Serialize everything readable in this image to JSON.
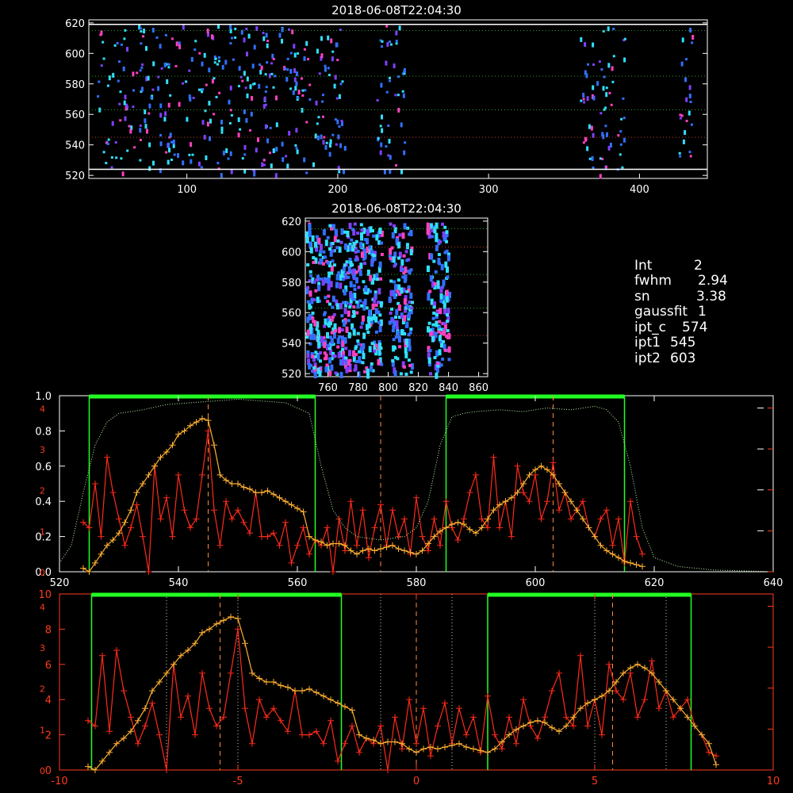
{
  "colors": {
    "axis_white": "#ffffff",
    "axis_red": "#ff3b1f",
    "profile_red": "#ff2a1a",
    "profile_orange": "#ffb030",
    "window_green": "#22ff22",
    "transmission": "#b8f7a8",
    "ref_dashed": "#ff8c3a",
    "grid_dot_green": "#2aa02a",
    "grid_dot_red": "#c04020",
    "pixel_blue": "#3070ff",
    "pixel_cyan": "#30e0ff",
    "pixel_purple": "#8040ff",
    "pixel_magenta": "#ff40c0"
  },
  "panels": {
    "top_title": "2018-06-08T22:04:30",
    "mid_title": "2018-06-08T22:04:30"
  },
  "info": {
    "int_label": "Int",
    "int_value": "2",
    "fwhm_label": "fwhm",
    "fwhm_value": "2.94",
    "sn_label": "sn",
    "sn_value": "3.38",
    "gaussfit_label": "gaussfit",
    "gaussfit_value": "1",
    "ipt_c_label": "ipt_c",
    "ipt_c_value": "574",
    "ipt1_label": "ipt1",
    "ipt1_value": "545",
    "ipt2_label": "ipt2",
    "ipt2_value": "603"
  },
  "chart_data": [
    {
      "type": "heatmap",
      "title": "2018-06-08T22:04:30",
      "xlim": [
        35,
        445
      ],
      "ylim": [
        518,
        622
      ],
      "xticks": [
        "100",
        "200",
        "300",
        "400"
      ],
      "yticks": [
        "520",
        "540",
        "560",
        "580",
        "600",
        "620"
      ],
      "band_columns": [
        [
          40,
          205
        ],
        [
          225,
          245
        ],
        [
          360,
          390
        ],
        [
          425,
          435
        ]
      ],
      "white_lines_y": [
        524,
        619
      ],
      "green_dotted_y": [
        585,
        563,
        615
      ],
      "red_dotted_y": [
        545
      ]
    },
    {
      "type": "heatmap",
      "title": "2018-06-08T22:04:30",
      "xlim": [
        745,
        866
      ],
      "ylim": [
        518,
        622
      ],
      "xticks": [
        "760",
        "780",
        "800",
        "820",
        "840",
        "860"
      ],
      "yticks": [
        "520",
        "540",
        "560",
        "580",
        "600",
        "620"
      ],
      "band_columns": [
        [
          745,
          775
        ],
        [
          775,
          795
        ],
        [
          800,
          815
        ],
        [
          825,
          840
        ]
      ],
      "green_dotted_y": [
        585,
        563,
        615
      ],
      "red_dotted_y": [
        545,
        603
      ]
    },
    {
      "type": "line",
      "xlim": [
        520,
        640
      ],
      "ylim": [
        0,
        1.0
      ],
      "xticks": [
        "520",
        "540",
        "560",
        "580",
        "600",
        "620",
        "640"
      ],
      "yticks": [
        "0.0",
        "0.2",
        "0.4",
        "0.6",
        "0.8",
        "1.0"
      ],
      "right_axis_ticks": [
        "0",
        "1",
        "2",
        "3",
        "4"
      ],
      "left_overlay_ticks": [
        "0",
        "1",
        "2",
        "3",
        "4"
      ],
      "green_windows": [
        [
          525,
          563
        ],
        [
          585,
          615
        ]
      ],
      "dashed_lines_x": [
        545,
        574,
        603
      ],
      "series": [
        {
          "role": "profile_red",
          "x": [
            524,
            525,
            526,
            527,
            528,
            529,
            530,
            531,
            532,
            533,
            534,
            535,
            536,
            537,
            538,
            539,
            540,
            541,
            542,
            543,
            544,
            545,
            546,
            547,
            548,
            549,
            550,
            551,
            552,
            553,
            554,
            555,
            556,
            557,
            558,
            559,
            560,
            561,
            562,
            563,
            564,
            565,
            566,
            567,
            568,
            569,
            570,
            571,
            572,
            573,
            574,
            575,
            576,
            577,
            578,
            579,
            580,
            581,
            582,
            583,
            584,
            585,
            586,
            587,
            588,
            589,
            590,
            591,
            592,
            593,
            594,
            595,
            596,
            597,
            598,
            599,
            600,
            601,
            602,
            603,
            604,
            605,
            606,
            607,
            608,
            609,
            610,
            611,
            612,
            613,
            614,
            615,
            616,
            617,
            618
          ],
          "y": [
            0.28,
            0.25,
            0.5,
            0.2,
            0.65,
            0.45,
            0.3,
            0.15,
            0.25,
            0.38,
            0.2,
            0.0,
            0.6,
            0.3,
            0.42,
            0.2,
            0.55,
            0.35,
            0.25,
            0.3,
            0.55,
            0.8,
            0.35,
            0.15,
            0.4,
            0.3,
            0.35,
            0.28,
            0.22,
            0.45,
            0.2,
            0.2,
            0.22,
            0.15,
            0.28,
            0.05,
            0.15,
            0.25,
            0.1,
            0.18,
            0.15,
            0.25,
            0.0,
            0.3,
            0.12,
            0.4,
            0.15,
            0.35,
            0.08,
            0.25,
            0.38,
            0.15,
            0.35,
            0.2,
            0.3,
            0.1,
            0.42,
            0.2,
            0.12,
            0.3,
            0.15,
            0.4,
            0.25,
            0.18,
            0.3,
            0.45,
            0.55,
            0.3,
            0.25,
            0.65,
            0.25,
            0.4,
            0.2,
            0.6,
            0.45,
            0.4,
            0.55,
            0.3,
            0.4,
            0.62,
            0.35,
            0.45,
            0.3,
            0.35,
            0.4,
            0.25,
            0.2,
            0.3,
            0.35,
            0.15,
            0.3,
            0.05,
            0.4,
            0.2,
            0.1
          ]
        },
        {
          "role": "profile_orange",
          "x": [
            524,
            525,
            526,
            527,
            528,
            529,
            530,
            531,
            532,
            533,
            534,
            535,
            536,
            537,
            538,
            539,
            540,
            541,
            542,
            543,
            544,
            545,
            546,
            547,
            548,
            549,
            550,
            551,
            552,
            553,
            554,
            555,
            556,
            557,
            558,
            559,
            560,
            561,
            562,
            563,
            564,
            565,
            566,
            567,
            568,
            569,
            570,
            571,
            572,
            573,
            574,
            575,
            576,
            577,
            578,
            579,
            580,
            581,
            582,
            583,
            584,
            585,
            586,
            587,
            588,
            589,
            590,
            591,
            592,
            593,
            594,
            595,
            596,
            597,
            598,
            599,
            600,
            601,
            602,
            603,
            604,
            605,
            606,
            607,
            608,
            609,
            610,
            611,
            612,
            613,
            614,
            615,
            616,
            617,
            618
          ],
          "y": [
            0.02,
            0.0,
            0.05,
            0.1,
            0.15,
            0.18,
            0.22,
            0.28,
            0.35,
            0.45,
            0.5,
            0.55,
            0.6,
            0.65,
            0.68,
            0.72,
            0.78,
            0.8,
            0.83,
            0.85,
            0.87,
            0.86,
            0.72,
            0.55,
            0.52,
            0.5,
            0.5,
            0.48,
            0.47,
            0.45,
            0.45,
            0.46,
            0.44,
            0.42,
            0.4,
            0.38,
            0.36,
            0.34,
            0.2,
            0.18,
            0.17,
            0.15,
            0.16,
            0.16,
            0.15,
            0.12,
            0.1,
            0.12,
            0.13,
            0.12,
            0.13,
            0.14,
            0.15,
            0.13,
            0.12,
            0.11,
            0.1,
            0.12,
            0.16,
            0.2,
            0.23,
            0.25,
            0.27,
            0.28,
            0.27,
            0.24,
            0.22,
            0.25,
            0.3,
            0.35,
            0.38,
            0.4,
            0.42,
            0.45,
            0.5,
            0.55,
            0.58,
            0.6,
            0.58,
            0.55,
            0.5,
            0.45,
            0.4,
            0.35,
            0.3,
            0.25,
            0.2,
            0.15,
            0.12,
            0.1,
            0.08,
            0.06,
            0.05,
            0.04,
            0.03
          ]
        },
        {
          "role": "transmission",
          "x": [
            520,
            522,
            524,
            526,
            528,
            530,
            534,
            538,
            542,
            546,
            550,
            554,
            558,
            562,
            564,
            566,
            568,
            570,
            574,
            578,
            580,
            582,
            584,
            586,
            588,
            590,
            594,
            598,
            602,
            606,
            610,
            612,
            614,
            616,
            618,
            620,
            624,
            630,
            640
          ],
          "y": [
            0.05,
            0.15,
            0.45,
            0.72,
            0.85,
            0.9,
            0.92,
            0.95,
            0.96,
            0.97,
            0.98,
            0.97,
            0.96,
            0.9,
            0.6,
            0.35,
            0.25,
            0.2,
            0.18,
            0.2,
            0.25,
            0.4,
            0.72,
            0.88,
            0.9,
            0.91,
            0.92,
            0.91,
            0.93,
            0.92,
            0.94,
            0.92,
            0.85,
            0.6,
            0.25,
            0.08,
            0.03,
            0.01,
            0.0
          ]
        }
      ]
    },
    {
      "type": "line",
      "xlim": [
        -10,
        10
      ],
      "ylim": [
        0,
        10
      ],
      "xticks": [
        "-10",
        "-5",
        "0",
        "5",
        "10"
      ],
      "yticks": [
        "0",
        "2",
        "4",
        "6",
        "8",
        "10"
      ],
      "left_overlay_ticks": [
        "0",
        "1",
        "2",
        "3",
        "4"
      ],
      "green_windows": [
        [
          -9.1,
          -2.1
        ],
        [
          2,
          7.7
        ]
      ],
      "dashed_lines_x": [
        -5.5,
        0,
        5.5
      ],
      "dotted_lines_x": [
        -7,
        -5,
        -1,
        1,
        5,
        7
      ],
      "series": [
        {
          "role": "profile_red",
          "x": [
            -9.2,
            -9.0,
            -8.8,
            -8.6,
            -8.4,
            -8.2,
            -8.0,
            -7.8,
            -7.6,
            -7.4,
            -7.2,
            -7.0,
            -6.8,
            -6.6,
            -6.4,
            -6.2,
            -6.0,
            -5.8,
            -5.6,
            -5.4,
            -5.2,
            -5.0,
            -4.8,
            -4.6,
            -4.4,
            -4.2,
            -4.0,
            -3.8,
            -3.6,
            -3.4,
            -3.2,
            -3.0,
            -2.8,
            -2.6,
            -2.4,
            -2.2,
            -2.0,
            -1.8,
            -1.6,
            -1.4,
            -1.2,
            -1.0,
            -0.8,
            -0.6,
            -0.4,
            -0.2,
            0.0,
            0.2,
            0.4,
            0.6,
            0.8,
            1.0,
            1.2,
            1.4,
            1.6,
            1.8,
            2.0,
            2.2,
            2.4,
            2.6,
            2.8,
            3.0,
            3.2,
            3.4,
            3.6,
            3.8,
            4.0,
            4.2,
            4.4,
            4.6,
            4.8,
            5.0,
            5.2,
            5.4,
            5.6,
            5.8,
            6.0,
            6.2,
            6.4,
            6.6,
            6.8,
            7.0,
            7.2,
            7.4,
            7.6,
            7.8,
            8.0,
            8.2,
            8.4
          ],
          "y": [
            2.8,
            2.5,
            6.5,
            2.2,
            6.8,
            4.5,
            3.0,
            1.5,
            2.5,
            3.8,
            2.0,
            0.0,
            6.0,
            3.0,
            4.2,
            2.0,
            5.5,
            3.5,
            2.5,
            3.0,
            5.5,
            8.0,
            3.5,
            1.5,
            4.0,
            3.0,
            3.5,
            2.8,
            2.2,
            4.5,
            2.0,
            2.0,
            2.2,
            1.5,
            2.8,
            0.5,
            1.5,
            2.5,
            1.0,
            1.8,
            1.5,
            2.5,
            0.0,
            3.0,
            1.2,
            4.0,
            1.5,
            3.5,
            0.8,
            2.5,
            3.8,
            1.5,
            3.5,
            2.0,
            3.0,
            1.0,
            4.2,
            2.0,
            1.2,
            3.0,
            1.5,
            4.0,
            2.5,
            1.8,
            3.0,
            4.5,
            5.5,
            3.0,
            2.5,
            6.5,
            2.5,
            4.0,
            2.0,
            6.0,
            4.5,
            4.0,
            5.5,
            3.0,
            4.0,
            6.2,
            3.5,
            4.5,
            3.0,
            3.5,
            4.0,
            2.5,
            2.0,
            1.0,
            0.8
          ]
        },
        {
          "role": "profile_orange",
          "x": [
            -9.2,
            -9.0,
            -8.8,
            -8.6,
            -8.4,
            -8.2,
            -8.0,
            -7.8,
            -7.6,
            -7.4,
            -7.2,
            -7.0,
            -6.8,
            -6.6,
            -6.4,
            -6.2,
            -6.0,
            -5.8,
            -5.6,
            -5.4,
            -5.2,
            -5.0,
            -4.8,
            -4.6,
            -4.4,
            -4.2,
            -4.0,
            -3.8,
            -3.6,
            -3.4,
            -3.2,
            -3.0,
            -2.8,
            -2.6,
            -2.4,
            -2.2,
            -2.0,
            -1.8,
            -1.6,
            -1.4,
            -1.2,
            -1.0,
            -0.8,
            -0.6,
            -0.4,
            -0.2,
            0.0,
            0.2,
            0.4,
            0.6,
            0.8,
            1.0,
            1.2,
            1.4,
            1.6,
            1.8,
            2.0,
            2.2,
            2.4,
            2.6,
            2.8,
            3.0,
            3.2,
            3.4,
            3.6,
            3.8,
            4.0,
            4.2,
            4.4,
            4.6,
            4.8,
            5.0,
            5.2,
            5.4,
            5.6,
            5.8,
            6.0,
            6.2,
            6.4,
            6.6,
            6.8,
            7.0,
            7.2,
            7.4,
            7.6,
            7.8,
            8.0,
            8.2,
            8.4
          ],
          "y": [
            0.2,
            0.0,
            0.5,
            1.0,
            1.5,
            1.8,
            2.2,
            2.8,
            3.5,
            4.5,
            5.0,
            5.5,
            6.0,
            6.5,
            6.8,
            7.2,
            7.8,
            8.0,
            8.3,
            8.5,
            8.7,
            8.6,
            7.2,
            5.5,
            5.2,
            5.0,
            5.0,
            4.8,
            4.7,
            4.5,
            4.5,
            4.6,
            4.4,
            4.2,
            4.0,
            3.8,
            3.6,
            3.4,
            2.0,
            1.8,
            1.7,
            1.5,
            1.6,
            1.6,
            1.5,
            1.2,
            1.0,
            1.2,
            1.3,
            1.2,
            1.3,
            1.4,
            1.5,
            1.3,
            1.2,
            1.1,
            1.0,
            1.2,
            1.6,
            2.0,
            2.3,
            2.5,
            2.7,
            2.8,
            2.7,
            2.4,
            2.2,
            2.5,
            3.0,
            3.5,
            3.8,
            4.0,
            4.2,
            4.5,
            5.0,
            5.5,
            5.8,
            6.0,
            5.8,
            5.5,
            5.0,
            4.5,
            4.0,
            3.5,
            3.0,
            2.5,
            2.0,
            1.5,
            0.3
          ]
        }
      ]
    }
  ]
}
